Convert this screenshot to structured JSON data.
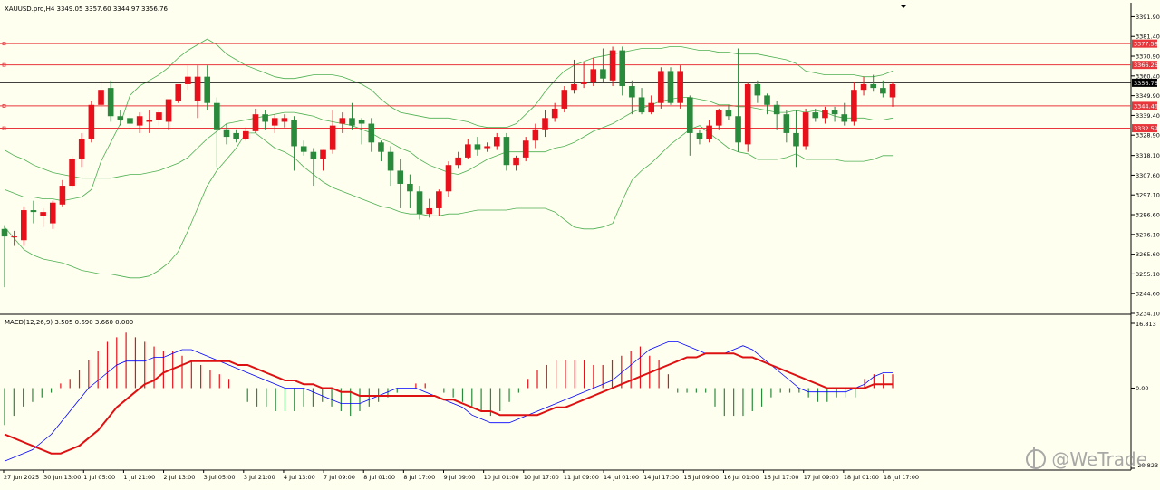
{
  "chart_data": [
    {
      "type": "candlestick",
      "title": "XAUUSD.pro,H4  3349.05 3357.60 3344.97 3356.76",
      "ylim": [
        3234.1,
        3395.0
      ],
      "y_ticks": [
        "3391.90",
        "3381.40",
        "3370.90",
        "3360.40",
        "3349.90",
        "3339.40",
        "3328.90",
        "3318.10",
        "3307.60",
        "3297.10",
        "3286.60",
        "3276.10",
        "3265.60",
        "3255.10",
        "3244.60",
        "3234.10"
      ],
      "x_labels": [
        "27 Jun 2025",
        "30 Jun 13:00",
        "1 Jul 05:00",
        "1 Jul 21:00",
        "2 Jul 13:00",
        "3 Jul 05:00",
        "3 Jul 21:00",
        "4 Jul 13:00",
        "7 Jul 09:00",
        "8 Jul 01:00",
        "8 Jul 17:00",
        "9 Jul 09:00",
        "10 Jul 01:00",
        "10 Jul 17:00",
        "11 Jul 09:00",
        "14 Jul 01:00",
        "14 Jul 17:00",
        "15 Jul 09:00",
        "16 Jul 01:00",
        "16 Jul 17:00",
        "17 Jul 09:00",
        "18 Jul 01:00",
        "18 Jul 17:00"
      ],
      "horizontal_lines": [
        {
          "value": 3377.58,
          "label": "3377.58",
          "color": "#e8363b"
        },
        {
          "value": 3366.26,
          "label": "3366.26",
          "color": "#e8363b"
        },
        {
          "value": 3344.46,
          "label": "3344.46",
          "color": "#e8363b"
        },
        {
          "value": 3332.59,
          "label": "3332.59",
          "color": "#e8363b"
        },
        {
          "value": 3356.76,
          "label": "3356.76",
          "color": "#000000"
        }
      ],
      "candles": [
        [
          3279,
          3281,
          3248,
          3275
        ],
        [
          3275,
          3278,
          3270,
          3275
        ],
        [
          3273,
          3291,
          3270,
          3289
        ],
        [
          3289,
          3294,
          3282,
          3288
        ],
        [
          3286,
          3290,
          3280,
          3288
        ],
        [
          3282,
          3294,
          3279,
          3293
        ],
        [
          3292,
          3305,
          3291,
          3302
        ],
        [
          3302,
          3318,
          3300,
          3316
        ],
        [
          3316,
          3330,
          3312,
          3327
        ],
        [
          3327,
          3347,
          3325,
          3345
        ],
        [
          3345,
          3358,
          3342,
          3353
        ],
        [
          3354,
          3358,
          3336,
          3339
        ],
        [
          3339,
          3342,
          3334,
          3337
        ],
        [
          3338,
          3341,
          3331,
          3335
        ],
        [
          3334,
          3341,
          3330,
          3339
        ],
        [
          3336,
          3342,
          3330,
          3337
        ],
        [
          3337,
          3342,
          3334,
          3341
        ],
        [
          3336,
          3347,
          3332,
          3348
        ],
        [
          3347,
          3355,
          3346,
          3356
        ],
        [
          3356,
          3366,
          3353,
          3360
        ],
        [
          3347,
          3366,
          3338,
          3360
        ],
        [
          3360,
          3366,
          3342,
          3346
        ],
        [
          3346,
          3349,
          3312,
          3332
        ],
        [
          3332,
          3335,
          3324,
          3328
        ],
        [
          3330,
          3332,
          3325,
          3327
        ],
        [
          3327,
          3333,
          3326,
          3331
        ],
        [
          3331,
          3343,
          3330,
          3340
        ],
        [
          3340,
          3342,
          3332,
          3336
        ],
        [
          3334,
          3340,
          3330,
          3338
        ],
        [
          3336,
          3340,
          3333,
          3338
        ],
        [
          3337,
          3339,
          3310,
          3323
        ],
        [
          3323,
          3326,
          3318,
          3320
        ],
        [
          3320,
          3322,
          3302,
          3316
        ],
        [
          3316,
          3321,
          3310,
          3321
        ],
        [
          3321,
          3342,
          3319,
          3334
        ],
        [
          3335,
          3341,
          3330,
          3338
        ],
        [
          3338,
          3346,
          3332,
          3334
        ],
        [
          3337,
          3338,
          3324,
          3335
        ],
        [
          3335,
          3338,
          3320,
          3325
        ],
        [
          3325,
          3326,
          3315,
          3320
        ],
        [
          3320,
          3323,
          3302,
          3310
        ],
        [
          3310,
          3316,
          3290,
          3303
        ],
        [
          3303,
          3308,
          3290,
          3299
        ],
        [
          3299,
          3302,
          3284,
          3287
        ],
        [
          3287,
          3295,
          3285,
          3290
        ],
        [
          3290,
          3300,
          3286,
          3299
        ],
        [
          3299,
          3315,
          3296,
          3313
        ],
        [
          3313,
          3320,
          3311,
          3317
        ],
        [
          3317,
          3327,
          3316,
          3324
        ],
        [
          3324,
          3328,
          3318,
          3321
        ],
        [
          3322,
          3325,
          3320,
          3323
        ],
        [
          3323,
          3330,
          3321,
          3328
        ],
        [
          3328,
          3330,
          3310,
          3313
        ],
        [
          3313,
          3318,
          3310,
          3317
        ],
        [
          3317,
          3328,
          3315,
          3326
        ],
        [
          3326,
          3335,
          3322,
          3332
        ],
        [
          3332,
          3342,
          3328,
          3338
        ],
        [
          3338,
          3346,
          3336,
          3343
        ],
        [
          3343,
          3355,
          3341,
          3353
        ],
        [
          3353,
          3369,
          3351,
          3356
        ],
        [
          3356,
          3368,
          3354,
          3357
        ],
        [
          3357,
          3370,
          3355,
          3364
        ],
        [
          3364,
          3375,
          3357,
          3359
        ],
        [
          3358,
          3376,
          3355,
          3374
        ],
        [
          3374,
          3376,
          3350,
          3355
        ],
        [
          3355,
          3358,
          3340,
          3349
        ],
        [
          3349,
          3354,
          3340,
          3341
        ],
        [
          3341,
          3350,
          3340,
          3346
        ],
        [
          3346,
          3365,
          3343,
          3363
        ],
        [
          3363,
          3365,
          3345,
          3346
        ],
        [
          3346,
          3366,
          3343,
          3363
        ],
        [
          3349,
          3350,
          3318,
          3330
        ],
        [
          3330,
          3332,
          3324,
          3327
        ],
        [
          3327,
          3337,
          3325,
          3334
        ],
        [
          3334,
          3343,
          3332,
          3342
        ],
        [
          3342,
          3345,
          3337,
          3339
        ],
        [
          3339,
          3375,
          3320,
          3325
        ],
        [
          3324,
          3357,
          3320,
          3356
        ],
        [
          3356,
          3358,
          3346,
          3350
        ],
        [
          3350,
          3351,
          3340,
          3345
        ],
        [
          3345,
          3347,
          3332,
          3340
        ],
        [
          3340,
          3342,
          3325,
          3330
        ],
        [
          3330,
          3342,
          3312,
          3323
        ],
        [
          3323,
          3343,
          3321,
          3341
        ],
        [
          3341,
          3343,
          3336,
          3338
        ],
        [
          3338,
          3344,
          3335,
          3342
        ],
        [
          3342,
          3344,
          3336,
          3340
        ],
        [
          3340,
          3346,
          3334,
          3336
        ],
        [
          3336,
          3357,
          3334,
          3353
        ],
        [
          3353,
          3360,
          3350,
          3356
        ],
        [
          3356,
          3361,
          3352,
          3354
        ],
        [
          3354,
          3358,
          3349,
          3351
        ],
        [
          3349,
          3357,
          3344,
          3356
        ]
      ],
      "bollinger": {
        "upper": [
          3300,
          3298,
          3296,
          3296,
          3295,
          3295,
          3294,
          3295,
          3296,
          3300,
          3315,
          3325,
          3335,
          3350,
          3355,
          3358,
          3361,
          3365,
          3370,
          3374,
          3377,
          3380,
          3377,
          3372,
          3369,
          3366,
          3364,
          3362,
          3360,
          3359,
          3359,
          3360,
          3361,
          3361,
          3361,
          3360,
          3358,
          3356,
          3353,
          3348,
          3344,
          3341,
          3340,
          3339,
          3338,
          3338,
          3338,
          3337,
          3336,
          3334,
          3333,
          3333,
          3333,
          3335,
          3340,
          3345,
          3352,
          3358,
          3363,
          3366,
          3368,
          3370,
          3371,
          3372,
          3373,
          3374,
          3375,
          3375,
          3375,
          3376,
          3376,
          3375,
          3374,
          3374,
          3373,
          3373,
          3372,
          3372,
          3372,
          3371,
          3370,
          3369,
          3367,
          3363,
          3362,
          3361,
          3361,
          3361,
          3361,
          3360,
          3360,
          3361,
          3363
        ],
        "middle": [
          3321,
          3318,
          3316,
          3313,
          3311,
          3309,
          3308,
          3307,
          3306,
          3306,
          3306,
          3306,
          3307,
          3308,
          3308,
          3309,
          3310,
          3312,
          3314,
          3317,
          3322,
          3327,
          3331,
          3335,
          3336,
          3337,
          3338,
          3339,
          3340,
          3341,
          3341,
          3340,
          3339,
          3337,
          3336,
          3335,
          3334,
          3332,
          3330,
          3327,
          3325,
          3322,
          3320,
          3316,
          3313,
          3311,
          3309,
          3308,
          3310,
          3313,
          3316,
          3318,
          3320,
          3320,
          3320,
          3320,
          3320,
          3322,
          3323,
          3325,
          3328,
          3331,
          3333,
          3335,
          3338,
          3341,
          3343,
          3345,
          3347,
          3348,
          3349,
          3349,
          3348,
          3347,
          3345,
          3345,
          3344,
          3344,
          3343,
          3342,
          3341,
          3341,
          3342,
          3341,
          3342,
          3341,
          3339,
          3338,
          3338,
          3338,
          3337,
          3337,
          3338
        ],
        "lower": [
          3280,
          3274,
          3268,
          3265,
          3263,
          3262,
          3261,
          3259,
          3257,
          3256,
          3255,
          3255,
          3254,
          3253,
          3253,
          3254,
          3257,
          3261,
          3267,
          3278,
          3290,
          3302,
          3310,
          3316,
          3322,
          3330,
          3330,
          3326,
          3322,
          3320,
          3317,
          3312,
          3308,
          3304,
          3301,
          3299,
          3297,
          3295,
          3293,
          3291,
          3290,
          3288,
          3287,
          3287,
          3286,
          3286,
          3287,
          3287,
          3288,
          3289,
          3289,
          3289,
          3289,
          3290,
          3290,
          3290,
          3290,
          3288,
          3284,
          3280,
          3279,
          3279,
          3280,
          3282,
          3294,
          3305,
          3310,
          3314,
          3319,
          3324,
          3328,
          3332,
          3334,
          3330,
          3326,
          3322,
          3320,
          3319,
          3316,
          3316,
          3316,
          3317,
          3319,
          3316,
          3316,
          3316,
          3316,
          3315,
          3315,
          3315,
          3316,
          3318,
          3318
        ]
      }
    },
    {
      "type": "macd",
      "title": "MACD(12,26,9) 3.505 0.690 3.660 0.000",
      "ylim": [
        -20.823,
        16.813
      ],
      "y_ticks": [
        "16.813",
        "0.00",
        "-20.823"
      ],
      "histogram": [
        -8,
        -6,
        -4,
        -3,
        -2,
        -1,
        1,
        2,
        4,
        6,
        8,
        10,
        11,
        12,
        11,
        10,
        9,
        8,
        8,
        7,
        6,
        5,
        4,
        3,
        2,
        0,
        -3,
        -4,
        -4,
        -5,
        -5,
        -5,
        -4,
        -4,
        -3,
        -4,
        -5,
        -6,
        -5,
        -4,
        -3,
        -2,
        -1,
        0,
        1,
        1,
        0,
        -1,
        -2,
        -3,
        -4,
        -5,
        -6,
        -5,
        -3,
        -1,
        2,
        4,
        5,
        6,
        6,
        6,
        6,
        5,
        5,
        6,
        7,
        8,
        9,
        7,
        6,
        3,
        -1,
        -1,
        -1,
        -1,
        -4,
        -6,
        -6,
        -6,
        -5,
        -4,
        -2,
        -1,
        -1,
        -1,
        -2,
        -3,
        -3,
        -2,
        -2,
        -2,
        2,
        3,
        3,
        3
      ],
      "macd_line": [
        -19,
        -18,
        -17,
        -16,
        -14,
        -12,
        -9,
        -6,
        -3,
        0,
        2,
        4,
        6,
        7,
        7,
        7,
        8,
        8,
        9,
        10,
        10,
        9,
        8,
        7,
        6,
        5,
        4,
        3,
        2,
        1,
        0,
        0,
        0,
        -1,
        -2,
        -3,
        -4,
        -4,
        -4,
        -3,
        -2,
        -1,
        0,
        0,
        0,
        -1,
        -2,
        -3,
        -4,
        -5,
        -7,
        -8,
        -9,
        -9,
        -9,
        -8,
        -7,
        -6,
        -5,
        -4,
        -3,
        -2,
        -1,
        0,
        1,
        2,
        4,
        6,
        8,
        10,
        11,
        12,
        12,
        11,
        10,
        9,
        9,
        9,
        10,
        11,
        10,
        8,
        6,
        4,
        2,
        0,
        -1,
        -1,
        -1,
        -1,
        -1,
        0,
        1,
        3,
        4,
        4
      ],
      "signal_line": [
        -12,
        -13,
        -14,
        -15,
        -16,
        -17,
        -17,
        -16,
        -15,
        -13,
        -11,
        -8,
        -5,
        -3,
        -1,
        1,
        2,
        4,
        5,
        6,
        7,
        7,
        7,
        7,
        7,
        6,
        6,
        5,
        4,
        3,
        2,
        2,
        1,
        1,
        0,
        0,
        -1,
        -1,
        -2,
        -2,
        -2,
        -2,
        -2,
        -2,
        -2,
        -2,
        -2,
        -3,
        -3,
        -4,
        -5,
        -6,
        -6,
        -7,
        -7,
        -7,
        -7,
        -7,
        -6,
        -5,
        -5,
        -4,
        -3,
        -2,
        -1,
        0,
        1,
        2,
        3,
        4,
        5,
        6,
        7,
        8,
        8,
        9,
        9,
        9,
        9,
        8,
        8,
        7,
        6,
        5,
        4,
        3,
        2,
        1,
        0,
        0,
        0,
        0,
        0,
        1,
        1,
        1
      ]
    }
  ],
  "watermark": "@WeTrade",
  "colors": {
    "bull": "#e8111b",
    "bear": "#2a8a3c",
    "bands": "#4caf50",
    "macd_main": "#0000ff",
    "macd_signal": "#dd1111",
    "background": "#fffff0",
    "sr_line": "#e8363b"
  }
}
